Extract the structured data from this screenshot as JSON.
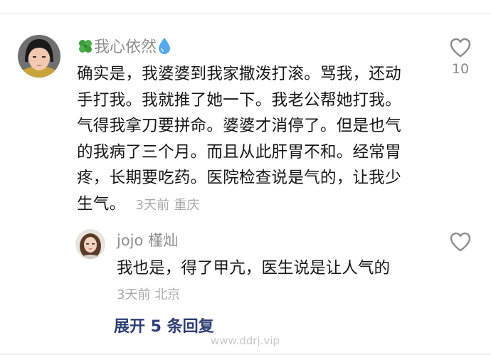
{
  "main_comment": {
    "username": "我心依然",
    "username_prefix_icon": "four-leaf-clover-icon",
    "username_suffix_icon": "water-drop-icon",
    "lines": [
      "确实是，我婆婆到我家撒泼打滚。骂我，还动",
      "手打我。我就推了她一下。我老公帮她打我。",
      "气得我拿刀要拼命。婆婆才消停了。但是也气",
      "的我病了三个月。而且从此肝胃不和。经常胃",
      "疼，长期要吃药。医院检查说是气的，让我少",
      "生气。"
    ],
    "time": "3天前",
    "location": "重庆",
    "like_icon": "heart-outline-icon",
    "likes": "10"
  },
  "reply": {
    "username": "jojo 槿灿",
    "text": "我也是，得了甲亢，医生说是让人气的",
    "time": "3天前",
    "location": "北京",
    "like_icon": "heart-outline-icon"
  },
  "expand_label": "展开 5 条回复",
  "watermark": "www.ddrj.vip"
}
